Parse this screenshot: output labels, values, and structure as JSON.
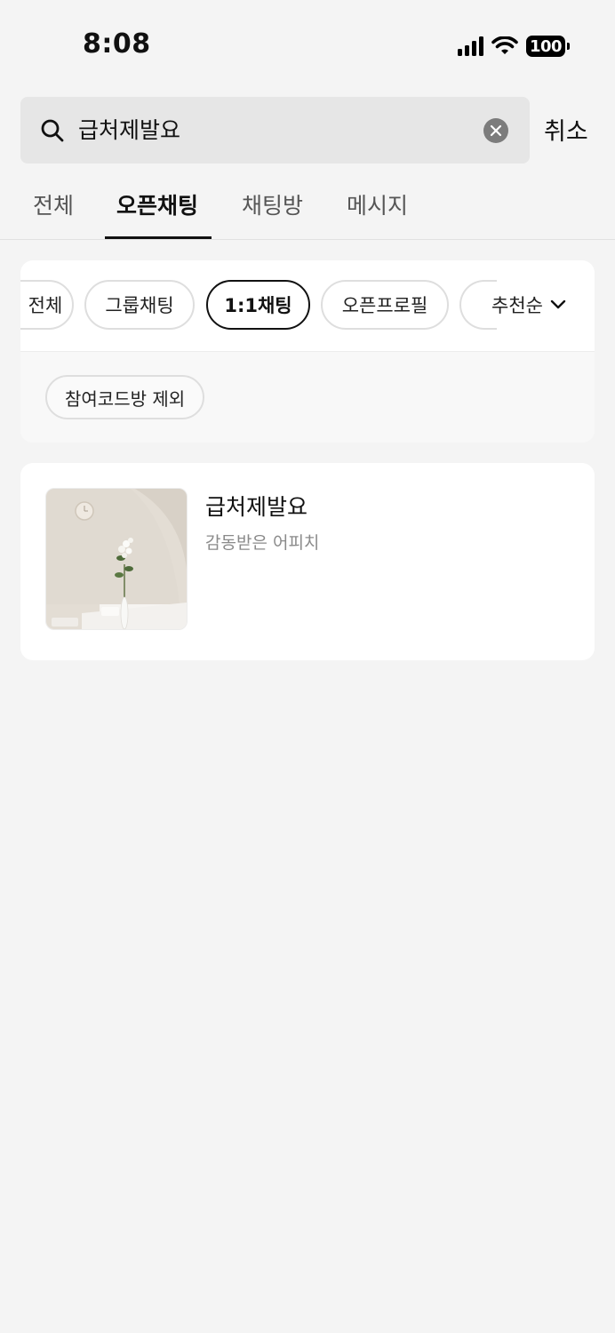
{
  "status_bar": {
    "time": "8:08",
    "battery": "100",
    "icons": [
      "signal-icon",
      "wifi-icon",
      "battery-icon"
    ]
  },
  "search": {
    "query": "급처제발요",
    "cancel_label": "취소"
  },
  "tabs": [
    {
      "label": "전체",
      "active": false
    },
    {
      "label": "오픈채팅",
      "active": true
    },
    {
      "label": "채팅방",
      "active": false
    },
    {
      "label": "메시지",
      "active": false
    }
  ],
  "filters": {
    "chips": [
      {
        "label": "전체",
        "selected": false
      },
      {
        "label": "그룹채팅",
        "selected": false
      },
      {
        "label": "1:1채팅",
        "selected": true
      },
      {
        "label": "오픈프로필",
        "selected": false
      }
    ],
    "sort_label": "추천순",
    "exclude_label": "참여코드방 제외"
  },
  "results": [
    {
      "title": "급처제발요",
      "subtitle": "감동받은 어피치"
    }
  ],
  "colors": {
    "background": "#f4f4f4",
    "card": "#ffffff",
    "text_primary": "#111111",
    "text_secondary": "#8a8a8a",
    "chip_border": "#dedede"
  }
}
